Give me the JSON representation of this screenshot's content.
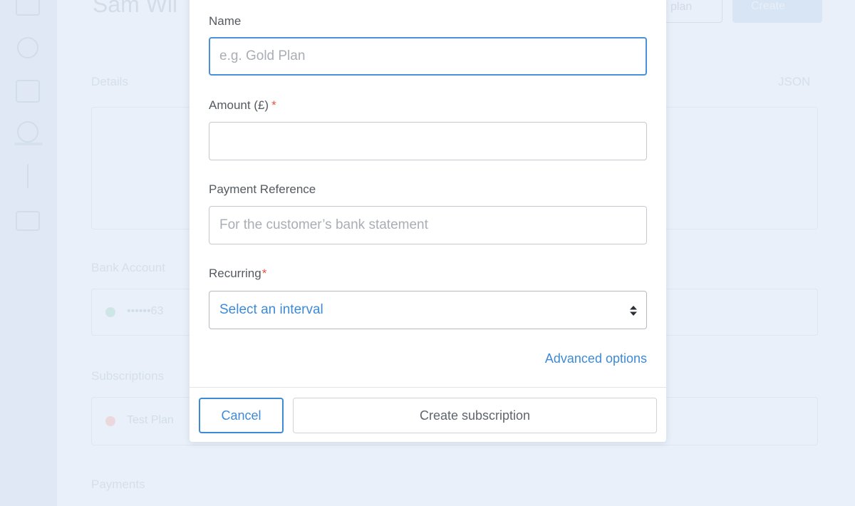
{
  "background": {
    "customer_name": "Sam Wil",
    "header_button_outline": "plan",
    "header_button_solid": "Create",
    "section_details": "Details",
    "section_json": "JSON",
    "section_bank_accounts": "Bank Account",
    "bank_account_mask": "••••••63",
    "section_subscriptions": "Subscriptions",
    "subscription_name": "Test Plan",
    "section_payments": "Payments"
  },
  "modal": {
    "name_field": {
      "label": "Name",
      "placeholder": "e.g. Gold Plan",
      "value": ""
    },
    "amount_field": {
      "label": "Amount (£)",
      "required_marker": "*",
      "value": ""
    },
    "reference_field": {
      "label": "Payment Reference",
      "placeholder": "For the customer’s bank statement",
      "value": ""
    },
    "recurring_field": {
      "label": "Recurring",
      "required_marker": "*",
      "selected": "Select an interval"
    },
    "advanced_link": "Advanced options",
    "cancel_label": "Cancel",
    "create_label": "Create subscription"
  },
  "colors": {
    "accent": "#3d8ad6",
    "required": "#e8543d",
    "overlay_bg": "#e6eef8"
  }
}
